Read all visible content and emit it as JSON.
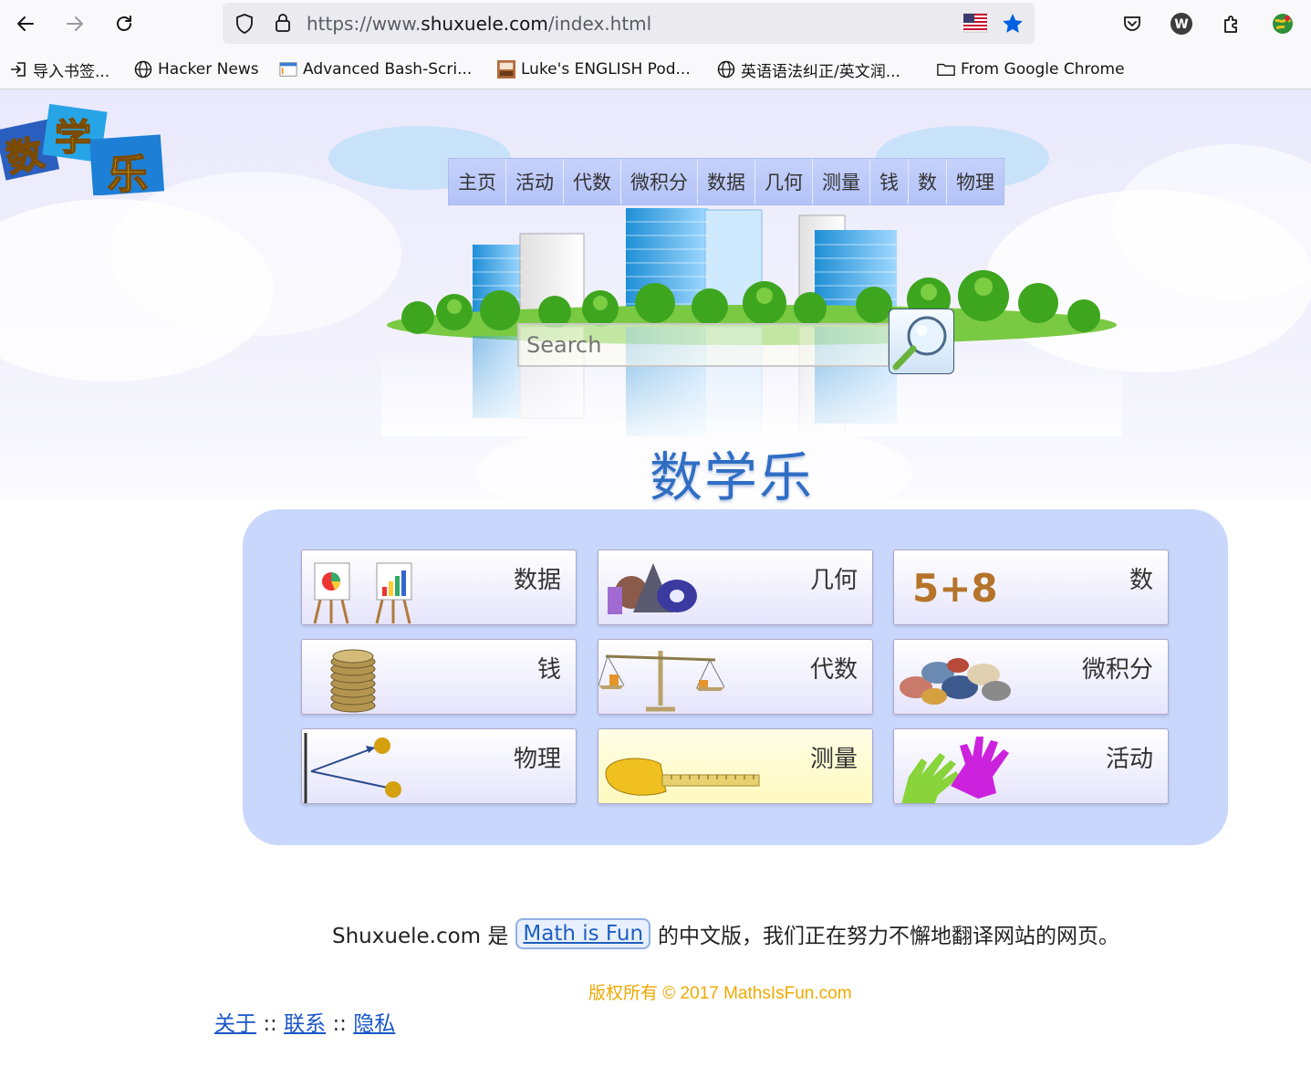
{
  "browser": {
    "url_prefix": "https://www.",
    "url_domain": "shuxuele.com",
    "url_path": "/index.html",
    "bookmarks": [
      {
        "label": "导入书签...",
        "icon": "import-icon"
      },
      {
        "label": "Hacker News",
        "icon": "globe-icon"
      },
      {
        "label": "Advanced Bash-Scri...",
        "icon": "page-icon"
      },
      {
        "label": "Luke's ENGLISH Pod...",
        "icon": "podcast-icon"
      },
      {
        "label": "英语语法纠正/英文润...",
        "icon": "globe-icon"
      },
      {
        "label": "From Google Chrome",
        "icon": "folder-icon"
      }
    ]
  },
  "nav": [
    "主页",
    "活动",
    "代数",
    "微积分",
    "数据",
    "几何",
    "测量",
    "钱",
    "数",
    "物理"
  ],
  "search": {
    "placeholder": "Search"
  },
  "hero": {
    "title": "数学乐",
    "logo_text": "数学乐"
  },
  "tiles": [
    {
      "label": "数据",
      "icon": "easel-charts-icon"
    },
    {
      "label": "几何",
      "icon": "geometric-solids-icon"
    },
    {
      "label": "数",
      "icon": "five-plus-eight-icon",
      "icon_text": "5+8"
    },
    {
      "label": "钱",
      "icon": "coin-stack-icon"
    },
    {
      "label": "代数",
      "icon": "balance-scale-icon"
    },
    {
      "label": "微积分",
      "icon": "pebbles-icon"
    },
    {
      "label": "物理",
      "icon": "vectors-icon"
    },
    {
      "label": "测量",
      "icon": "tape-measure-icon"
    },
    {
      "label": "活动",
      "icon": "hands-icon"
    }
  ],
  "footer": {
    "site": "Shuxuele.com 是",
    "link": "Math is Fun",
    "rest": "的中文版，我们正在努力不懈地翻译网站的网页。",
    "copyright": "版权所有 © 2017 MathsIsFun.com",
    "about": "关于",
    "contact": "联系",
    "privacy": "隐私",
    "sep": "::"
  }
}
